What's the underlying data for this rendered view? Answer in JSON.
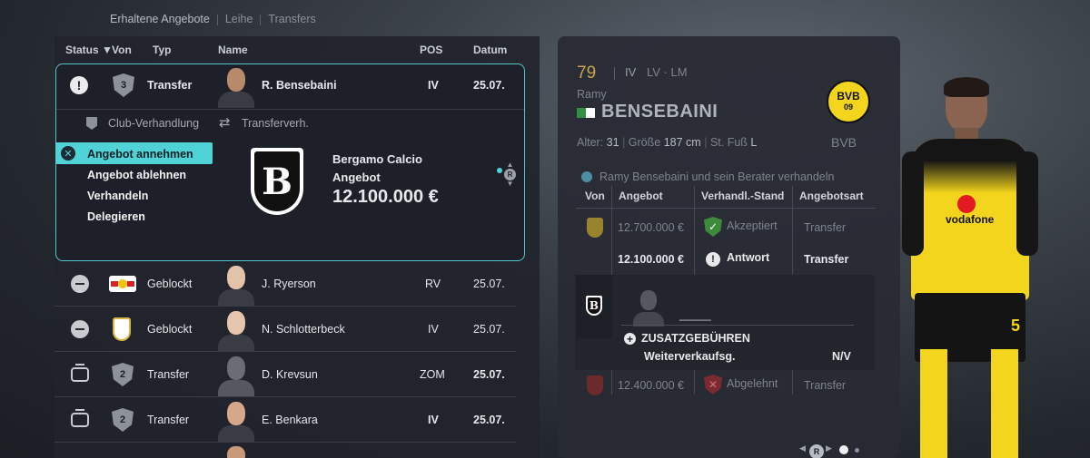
{
  "breadcrumb": {
    "items": [
      "Erhaltene Angebote",
      "Leihe",
      "Transfers"
    ]
  },
  "table": {
    "headers": {
      "status": "Status",
      "sort_arrow": "▼",
      "von": "Von",
      "typ": "Typ",
      "name": "Name",
      "pos": "POS",
      "datum": "Datum"
    },
    "expanded_row": {
      "club_rank": "3",
      "typ": "Transfer",
      "name": "R. Bensebaini",
      "pos": "IV",
      "datum": "25.07."
    },
    "rows": [
      {
        "status": "blocked",
        "club": "RB Leipzig",
        "typ": "Geblockt",
        "name": "J. Ryerson",
        "pos": "RV",
        "datum": "25.07."
      },
      {
        "status": "blocked",
        "club": "Real Madrid",
        "typ": "Geblockt",
        "name": "N. Schlotterbeck",
        "pos": "IV",
        "datum": "25.07."
      },
      {
        "status": "tv",
        "club_rank": "2",
        "typ": "Transfer",
        "name": "D. Krevsun",
        "pos": "ZOM",
        "datum": "25.07."
      },
      {
        "status": "tv",
        "club_rank": "2",
        "typ": "Transfer",
        "name": "E. Benkara",
        "pos": "IV",
        "datum": "25.07."
      }
    ]
  },
  "detail": {
    "club_negotiation": "Club-Verhandlung",
    "transfer_negotiation": "Transferverh.",
    "actions": [
      "Angebot annehmen",
      "Angebot ablehnen",
      "Verhandeln",
      "Delegieren"
    ],
    "club_name": "Bergamo Calcio",
    "offer_label": "Angebot",
    "offer_amount": "12.100.000 €",
    "r_button": "R"
  },
  "player": {
    "rating": "79",
    "positions_primary": "IV",
    "positions_secondary": "LV · LM",
    "first_name": "Ramy",
    "last_name": "BENSEBAINI",
    "age_label": "Alter:",
    "age": "31",
    "height_label": "Größe",
    "height": "187 cm",
    "foot_label": "St. Fuß",
    "foot": "L",
    "club_short": "BVB",
    "club_badge_top": "BVB",
    "club_badge_bottom": "09",
    "negotiation_note": "Ramy Bensebaini und sein Berater verhandeln"
  },
  "offers": {
    "headers": {
      "von": "Von",
      "angebot": "Angebot",
      "stand": "Verhandl.-Stand",
      "art": "Angebotsart"
    },
    "rows": [
      {
        "amount": "12.700.000 €",
        "status": "Akzeptiert",
        "art": "Transfer"
      },
      {
        "amount": "12.100.000 €",
        "status": "Antwort",
        "art": "Transfer"
      },
      {
        "amount": "12.400.000 €",
        "status": "Abgelehnt",
        "art": "Transfer"
      }
    ],
    "popup": {
      "placeholder": "_____",
      "extra_fees": "ZUSATZGEBÜHREN",
      "resale_label": "Weiterverkaufsg.",
      "resale_value": "N/V"
    }
  },
  "pager": {
    "r_button": "R"
  },
  "kit": {
    "sponsor": "vodafone",
    "number": "5"
  },
  "colors": {
    "accent": "#4fd3d6",
    "gold": "#c8a450",
    "bvb_yellow": "#f2d51c"
  }
}
